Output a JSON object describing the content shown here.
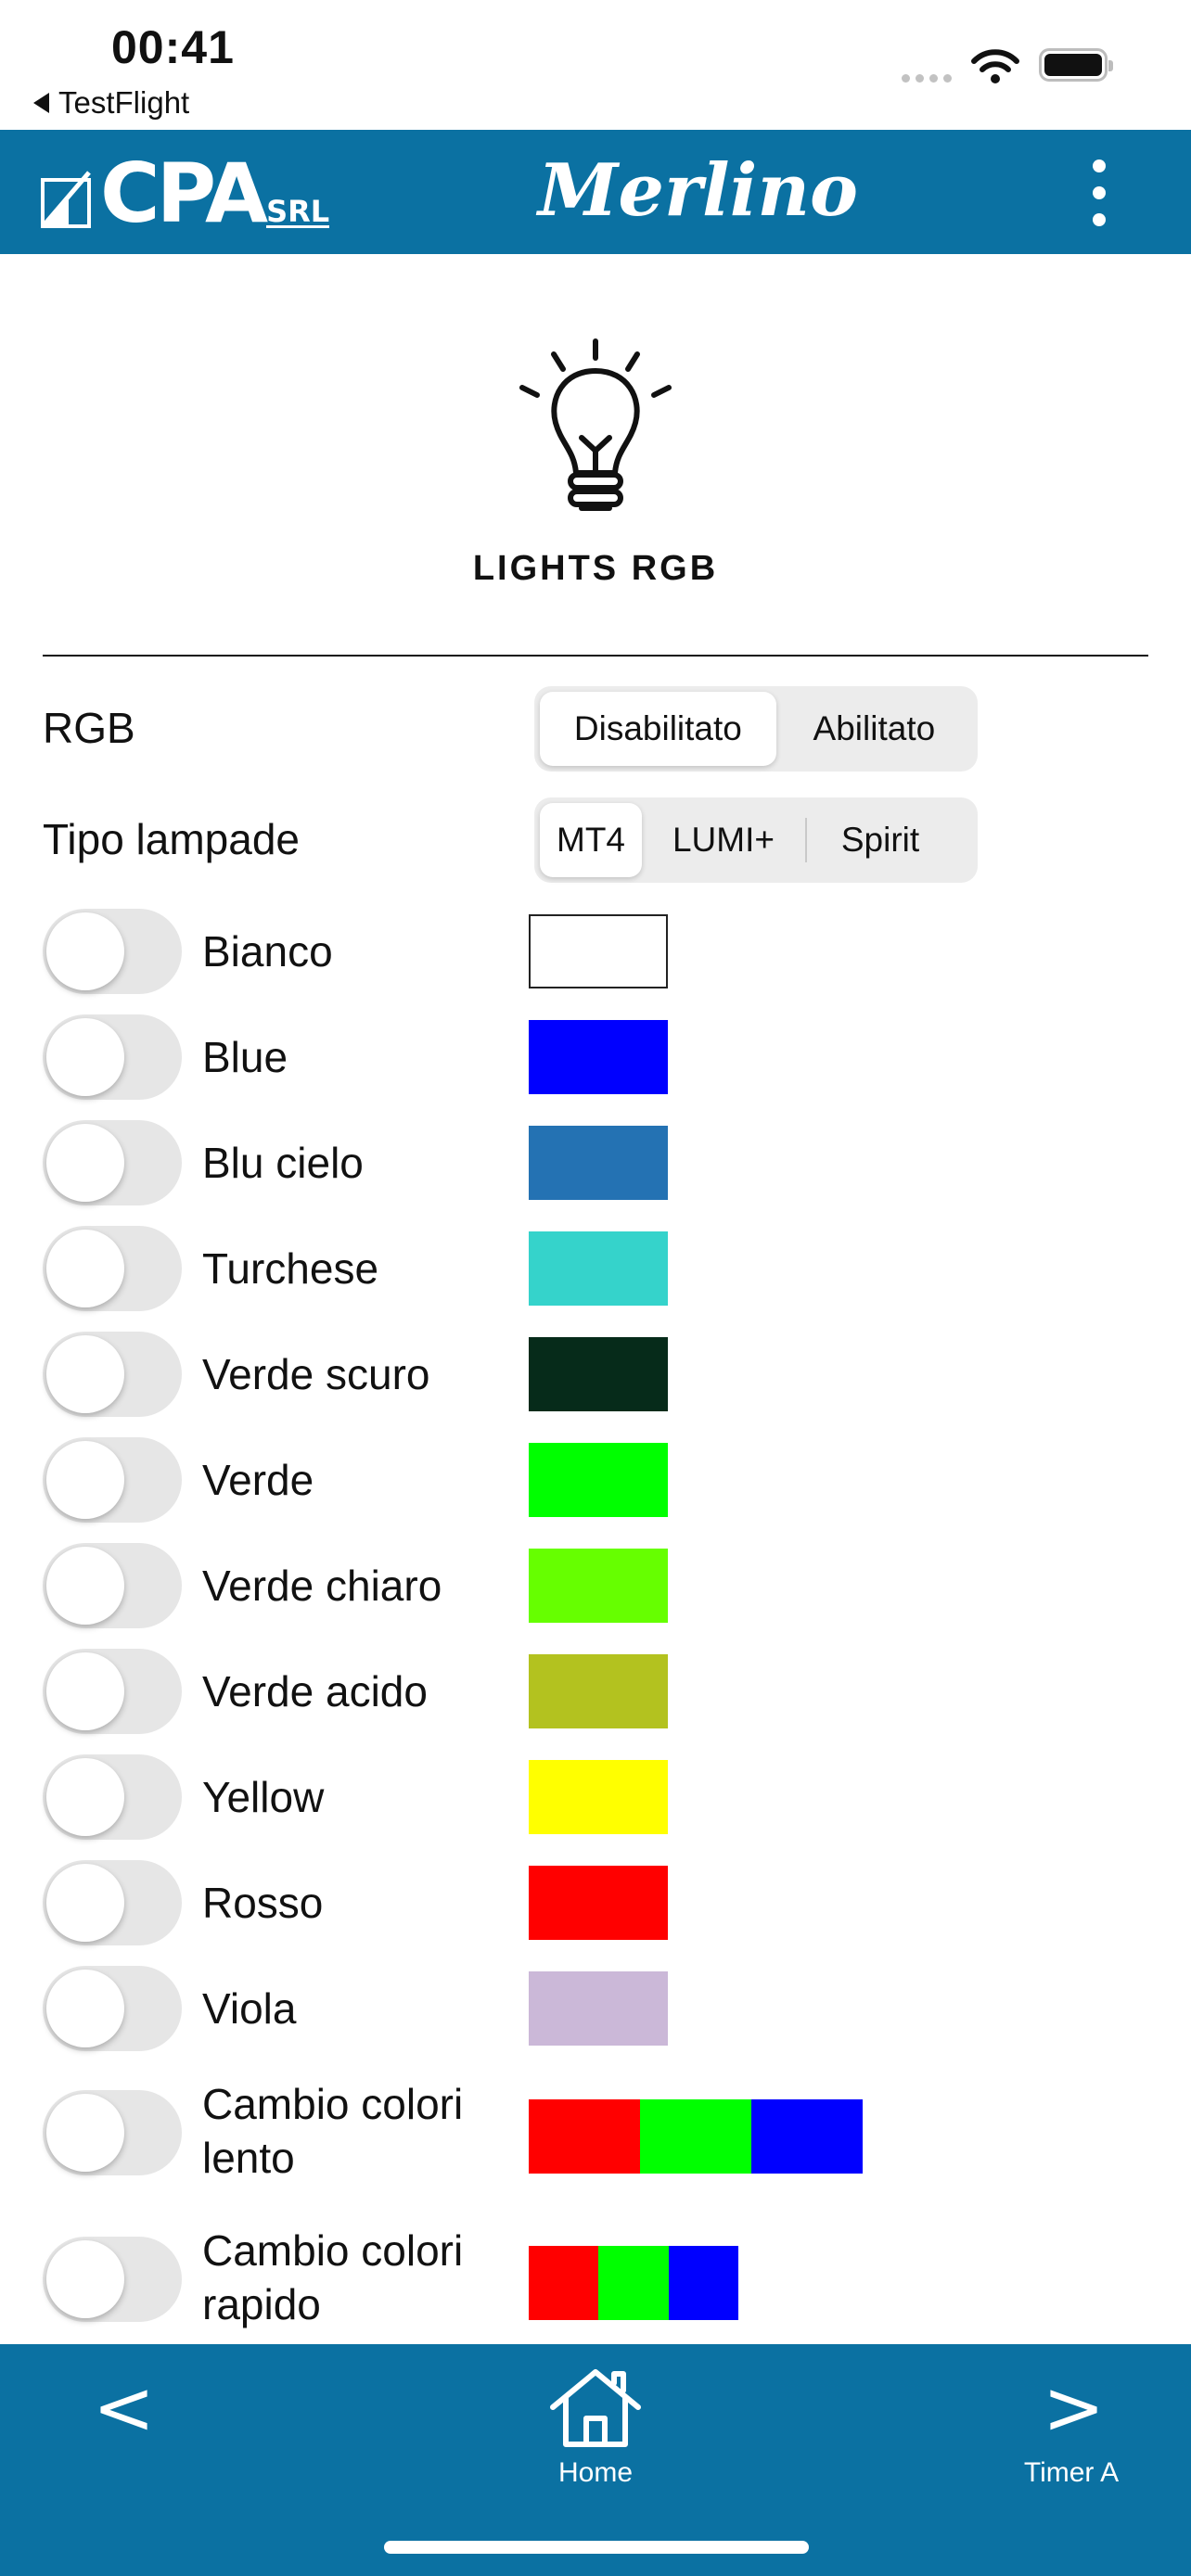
{
  "status_bar": {
    "time": "00:41",
    "back_app": "TestFlight"
  },
  "header": {
    "company_logo": "CPA",
    "company_suffix": "SRL",
    "app_name": "Merlino",
    "menu_icon": "kebab-menu-icon"
  },
  "hero": {
    "icon": "light-bulb-icon",
    "title": "LIGHTS RGB"
  },
  "settings": {
    "rgb": {
      "label": "RGB",
      "options": [
        "Disabilitato",
        "Abilitato"
      ],
      "selected": "Disabilitato"
    },
    "lamp_type": {
      "label": "Tipo lampade",
      "options": [
        "MT4",
        "LUMI+",
        "Spirit"
      ],
      "selected": "MT4"
    }
  },
  "colors": [
    {
      "name": "Bianco",
      "enabled": false,
      "swatch": [
        "#ffffff"
      ]
    },
    {
      "name": "Blue",
      "enabled": false,
      "swatch": [
        "#0000ff"
      ]
    },
    {
      "name": "Blu cielo",
      "enabled": false,
      "swatch": [
        "#2472b3"
      ]
    },
    {
      "name": "Turchese",
      "enabled": false,
      "swatch": [
        "#35d3cb"
      ]
    },
    {
      "name": "Verde scuro",
      "enabled": false,
      "swatch": [
        "#062b1a"
      ]
    },
    {
      "name": "Verde",
      "enabled": false,
      "swatch": [
        "#00ff00"
      ]
    },
    {
      "name": "Verde chiaro",
      "enabled": false,
      "swatch": [
        "#66ff00"
      ]
    },
    {
      "name": "Verde acido",
      "enabled": false,
      "swatch": [
        "#b3c21f"
      ]
    },
    {
      "name": "Yellow",
      "enabled": false,
      "swatch": [
        "#ffff00"
      ]
    },
    {
      "name": "Rosso",
      "enabled": false,
      "swatch": [
        "#ff0000"
      ]
    },
    {
      "name": "Viola",
      "enabled": false,
      "swatch": [
        "#cbb8d8"
      ]
    },
    {
      "name": "Cambio colori lento",
      "enabled": false,
      "swatch": [
        "#ff0000",
        "#00ff00",
        "#0000ff"
      ]
    },
    {
      "name": "Cambio colori rapido",
      "enabled": false,
      "swatch": [
        "#ff0000",
        "#00ff00",
        "#0000ff"
      ]
    }
  ],
  "bottom_nav": {
    "prev_label": "<",
    "home_label": "Home",
    "next_label": ">",
    "next_caption": "Timer A"
  },
  "theme": {
    "brand_blue": "#0b71a2"
  }
}
